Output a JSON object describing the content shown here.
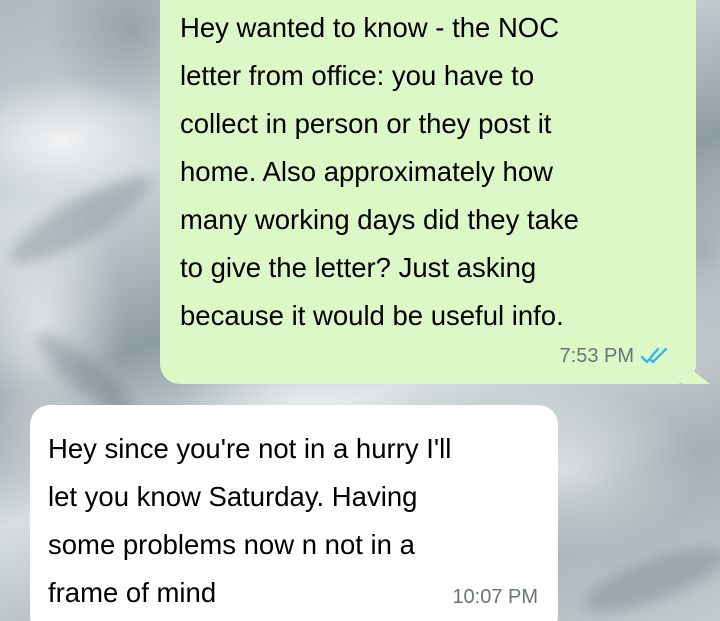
{
  "messages": [
    {
      "direction": "outgoing",
      "text": "Hey wanted to know - the NOC\nletter from office: you have to\ncollect in person or they post it\nhome. Also approximately how\nmany working days did they take\nto give the letter? Just asking\nbecause it would be useful info.",
      "time": "7:53 PM",
      "status_icon": "double-check-read-icon"
    },
    {
      "direction": "incoming",
      "text": "Hey since you're not in a hurry I'll\nlet you know Saturday. Having\nsome problems now n not in a\nframe of mind",
      "time": "10:07 PM"
    }
  ],
  "colors": {
    "outgoing_bubble": "#dcf8c6",
    "incoming_bubble": "#ffffff",
    "read_ticks": "#34b7f1",
    "timestamp": "#6b7478"
  }
}
